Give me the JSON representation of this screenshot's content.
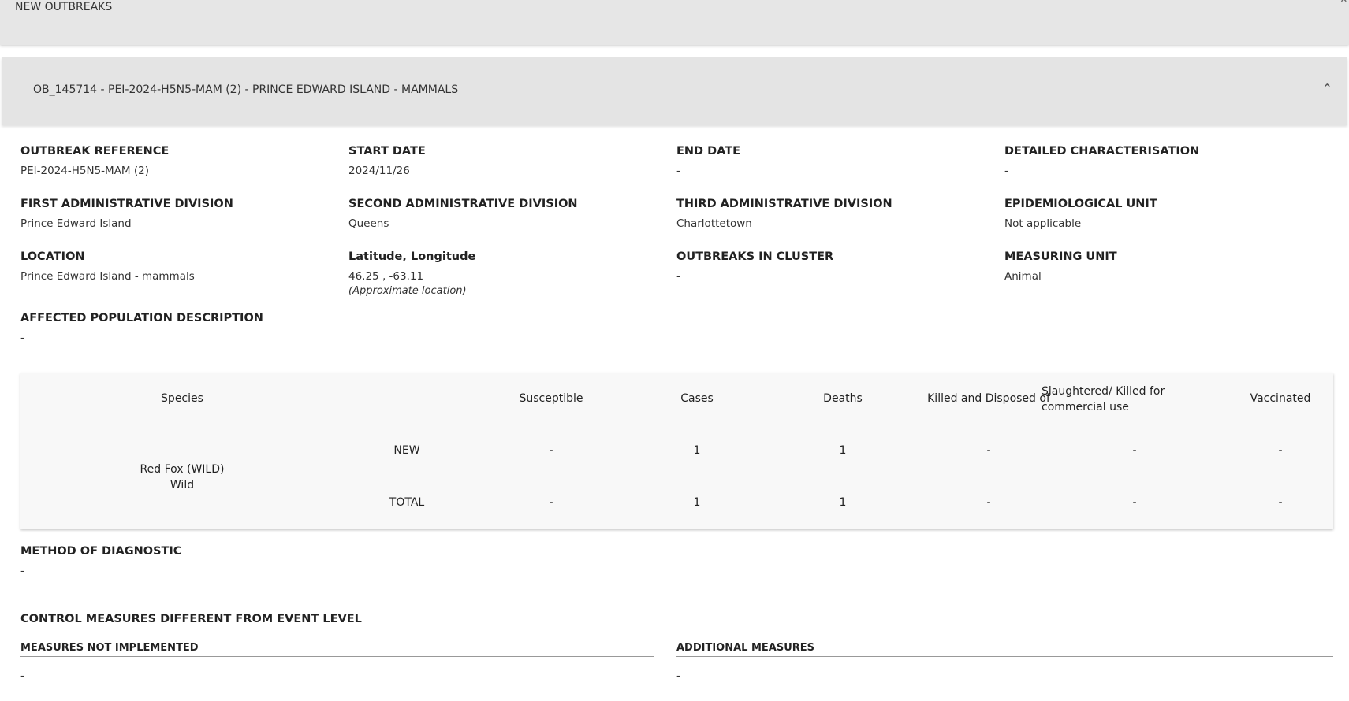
{
  "new_outbreaks_label": "NEW OUTBREAKS",
  "outbreak_title": "OB_145714 - PEI-2024-H5N5-MAM (2) - PRINCE EDWARD ISLAND - MAMMALS",
  "fields": {
    "outbreak_reference": {
      "label": "OUTBREAK REFERENCE",
      "value": "PEI-2024-H5N5-MAM (2)"
    },
    "start_date": {
      "label": "START DATE",
      "value": "2024/11/26"
    },
    "end_date": {
      "label": "END DATE",
      "value": "-"
    },
    "detailed_characterisation": {
      "label": "DETAILED CHARACTERISATION",
      "value": "-"
    },
    "first_admin_division": {
      "label": "FIRST ADMINISTRATIVE DIVISION",
      "value": "Prince Edward Island"
    },
    "second_admin_division": {
      "label": "SECOND ADMINISTRATIVE DIVISION",
      "value": "Queens"
    },
    "third_admin_division": {
      "label": "THIRD ADMINISTRATIVE DIVISION",
      "value": "Charlottetown"
    },
    "epidemiological_unit": {
      "label": "EPIDEMIOLOGICAL UNIT",
      "value": "Not applicable"
    },
    "location": {
      "label": "LOCATION",
      "value": "Prince Edward Island - mammals"
    },
    "lat_long": {
      "label": "Latitude, Longitude",
      "value": "46.25 , -63.11",
      "note": "(Approximate location)"
    },
    "outbreaks_in_cluster": {
      "label": "OUTBREAKS IN CLUSTER",
      "value": "-"
    },
    "measuring_unit": {
      "label": "MEASURING UNIT",
      "value": "Animal"
    },
    "affected_population": {
      "label": "AFFECTED POPULATION DESCRIPTION",
      "value": "-"
    }
  },
  "species_table": {
    "columns": {
      "species": "Species",
      "susceptible": "Susceptible",
      "cases": "Cases",
      "deaths": "Deaths",
      "killed": "Killed and Disposed of",
      "slaughtered": "Slaughtered/ Killed for commercial use",
      "vaccinated": "Vaccinated"
    },
    "species_name": "Red Fox (WILD)",
    "species_type": "Wild",
    "rows": [
      {
        "label": "NEW",
        "susceptible": "-",
        "cases": "1",
        "deaths": "1",
        "killed": "-",
        "slaughtered": "-",
        "vaccinated": "-"
      },
      {
        "label": "TOTAL",
        "susceptible": "-",
        "cases": "1",
        "deaths": "1",
        "killed": "-",
        "slaughtered": "-",
        "vaccinated": "-"
      }
    ]
  },
  "method_of_diagnostic": {
    "label": "METHOD OF DIAGNOSTIC",
    "value": "-"
  },
  "control_measures": {
    "title": "CONTROL MEASURES DIFFERENT FROM EVENT LEVEL",
    "not_implemented": {
      "label": "MEASURES NOT IMPLEMENTED",
      "value": "-"
    },
    "additional": {
      "label": "ADDITIONAL MEASURES",
      "value": "-"
    }
  }
}
